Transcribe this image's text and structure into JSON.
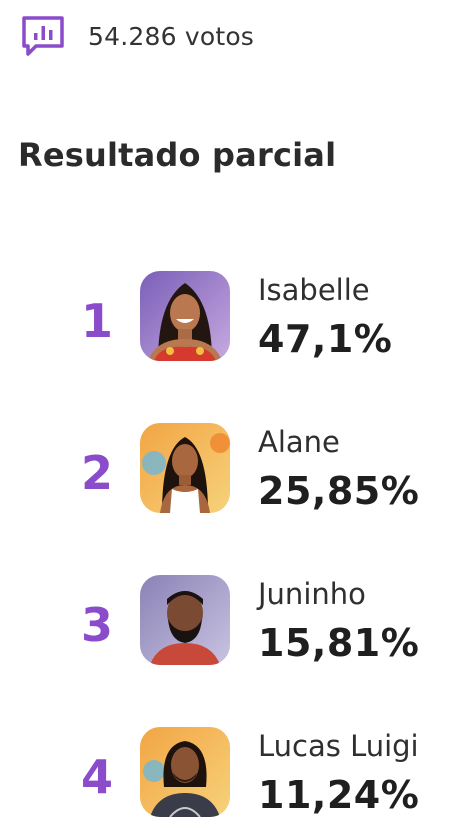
{
  "votes": {
    "icon": "poll-bar-chart-icon",
    "label": "54.286 votos"
  },
  "title": "Resultado parcial",
  "colors": {
    "accent": "#8b4ccc",
    "text": "#222222"
  },
  "results": [
    {
      "rank": "1",
      "name": "Isabelle",
      "percent": "47,1%",
      "avatar_icon": "participant-photo-icon"
    },
    {
      "rank": "2",
      "name": "Alane",
      "percent": "25,85%",
      "avatar_icon": "participant-photo-icon"
    },
    {
      "rank": "3",
      "name": "Juninho",
      "percent": "15,81%",
      "avatar_icon": "participant-photo-icon"
    },
    {
      "rank": "4",
      "name": "Lucas Luigi",
      "percent": "11,24%",
      "avatar_icon": "participant-photo-icon"
    }
  ]
}
